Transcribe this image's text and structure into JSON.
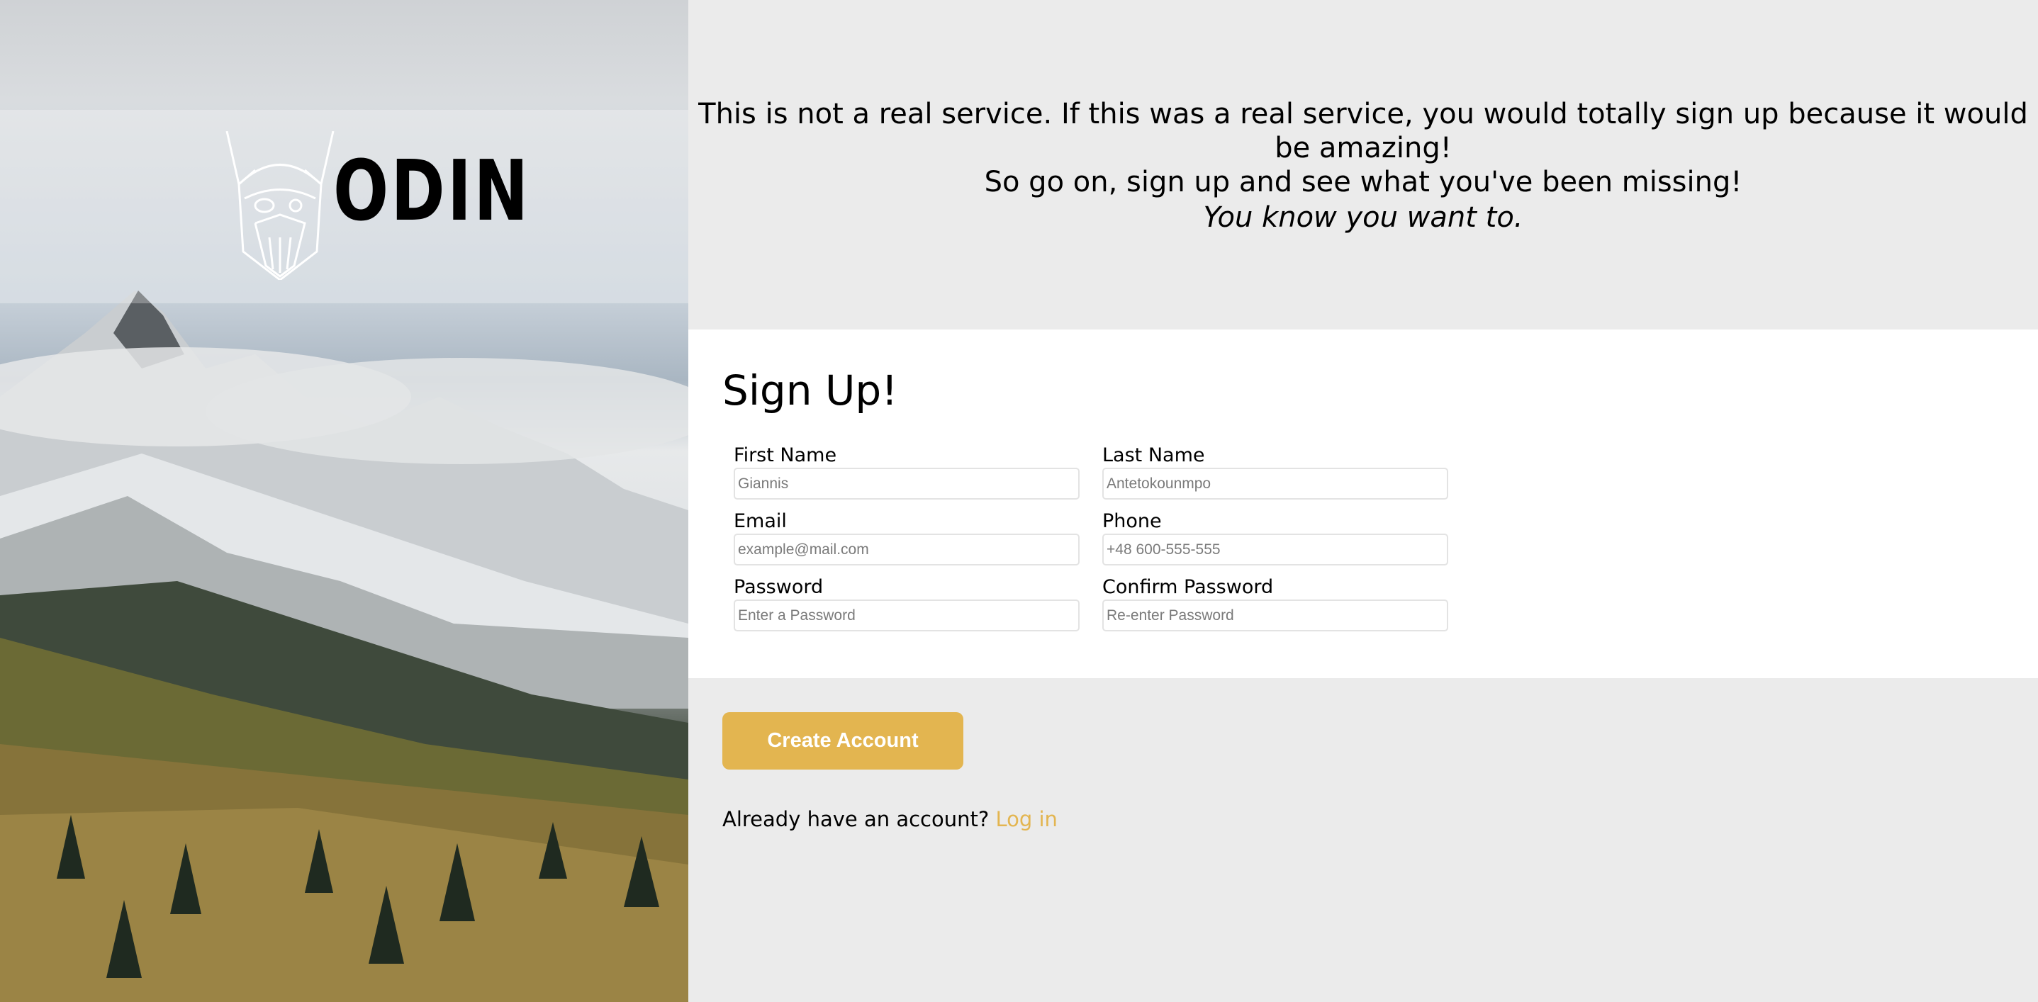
{
  "brand": {
    "name": "ODIN",
    "logo_icon": "viking-head-icon"
  },
  "intro": {
    "line1": "This is not a real service. If this was a real service, you would totally sign up because it would be amazing!",
    "line2": "So go on, sign up and see what you've been missing!",
    "tagline": "You know you want to."
  },
  "form": {
    "title": "Sign Up!",
    "fields": [
      {
        "label": "First Name",
        "placeholder": "Giannis"
      },
      {
        "label": "Last Name",
        "placeholder": "Antetokounmpo"
      },
      {
        "label": "Email",
        "placeholder": "example@mail.com"
      },
      {
        "label": "Phone",
        "placeholder": "+48 600-555-555"
      },
      {
        "label": "Password",
        "placeholder": "Enter a Password"
      },
      {
        "label": "Confirm Password",
        "placeholder": "Re-enter Password"
      }
    ]
  },
  "actions": {
    "create_label": "Create Account",
    "login_prompt": "Already have an account?",
    "login_link": "Log in"
  },
  "colors": {
    "accent": "#e3b550",
    "panel_bg": "#ebebeb",
    "form_bg": "#ffffff"
  }
}
